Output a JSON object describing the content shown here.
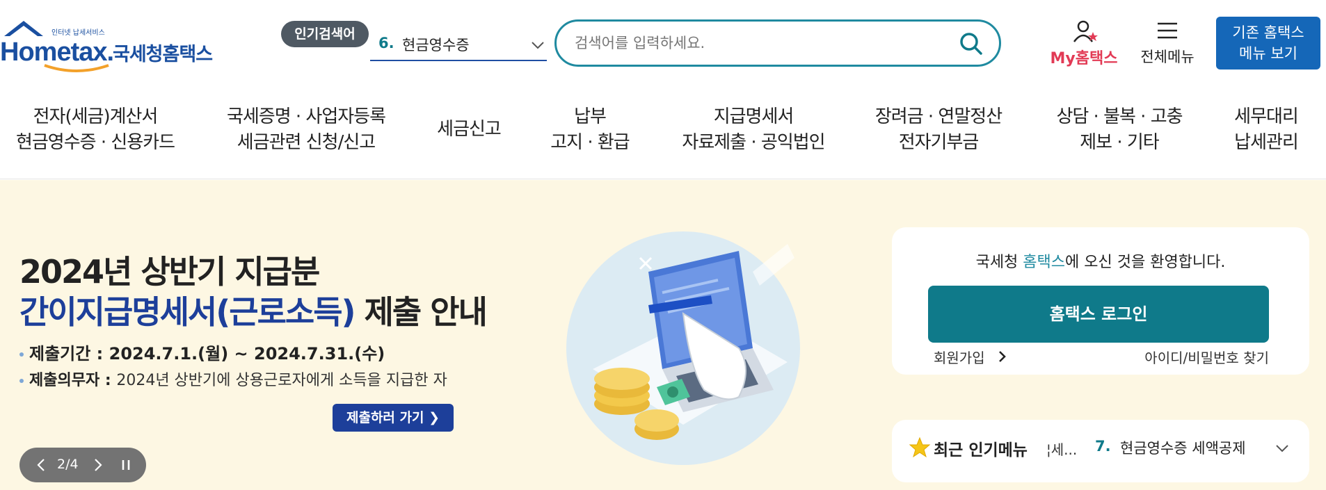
{
  "header": {
    "logo": {
      "small_text": "인터넷 납세서비스",
      "main_text_pre": "Hom",
      "main_text_e": "e",
      "main_text_post": "tax.",
      "korean_text": "국세청홈택스"
    },
    "popular_search": {
      "badge_label": "인기검색어",
      "rank": "6.",
      "term": "현금영수증"
    },
    "search": {
      "placeholder": "검색어를 입력하세요."
    },
    "my_hometax_label": "My홈택스",
    "all_menu_label": "전체메뉴",
    "old_menu_line1": "기존 홈택스",
    "old_menu_line2": "메뉴 보기"
  },
  "nav": {
    "items": [
      {
        "line1": "전자(세금)계산서",
        "line2": "현금영수증 · 신용카드"
      },
      {
        "line1": "국세증명 · 사업자등록",
        "line2": "세금관련 신청/신고"
      },
      {
        "line1": "세금신고",
        "line2": ""
      },
      {
        "line1": "납부",
        "line2": "고지 · 환급"
      },
      {
        "line1": "지급명세서",
        "line2": "자료제출 · 공익법인"
      },
      {
        "line1": "장려금 · 연말정산",
        "line2": "전자기부금"
      },
      {
        "line1": "상담 · 불복 · 고충",
        "line2": "제보 · 기타"
      },
      {
        "line1": "세무대리",
        "line2": "납세관리"
      }
    ]
  },
  "banner": {
    "title_line1": "2024년 상반기 지급분",
    "title_line2_blue": "간이지급명세서(근로소득)",
    "title_line2_dark": " 제출 안내",
    "bullet1": "제출기간 : 2024.7.1.(월) ~ 2024.7.31.(수)",
    "bullet2_label": "제출의무자 : ",
    "bullet2_text": "2024년 상반기에 상용근로자에게 소득을 지급한 자",
    "button_label": "제출하러 가기 ❯",
    "pager_count": "2/4"
  },
  "login": {
    "welcome_pre": "국세청 ",
    "welcome_hl": "홈택스",
    "welcome_post": "에 오신 것을 환영합니다.",
    "login_button": "홈택스 로그인",
    "join_label": "회원가입",
    "find_label": "아이디/비밀번호 찾기"
  },
  "recent": {
    "label": "최근 인기메뉴",
    "ticker": "¦세...",
    "rank": "7.",
    "text": "현금영수증 세액공제"
  },
  "colors": {
    "brand_blue": "#1a4fa0",
    "teal": "#0f7a8a",
    "old_menu_blue": "#1567b8",
    "hero_bg": "#fdf7e3",
    "my_pink": "#e23a55"
  }
}
